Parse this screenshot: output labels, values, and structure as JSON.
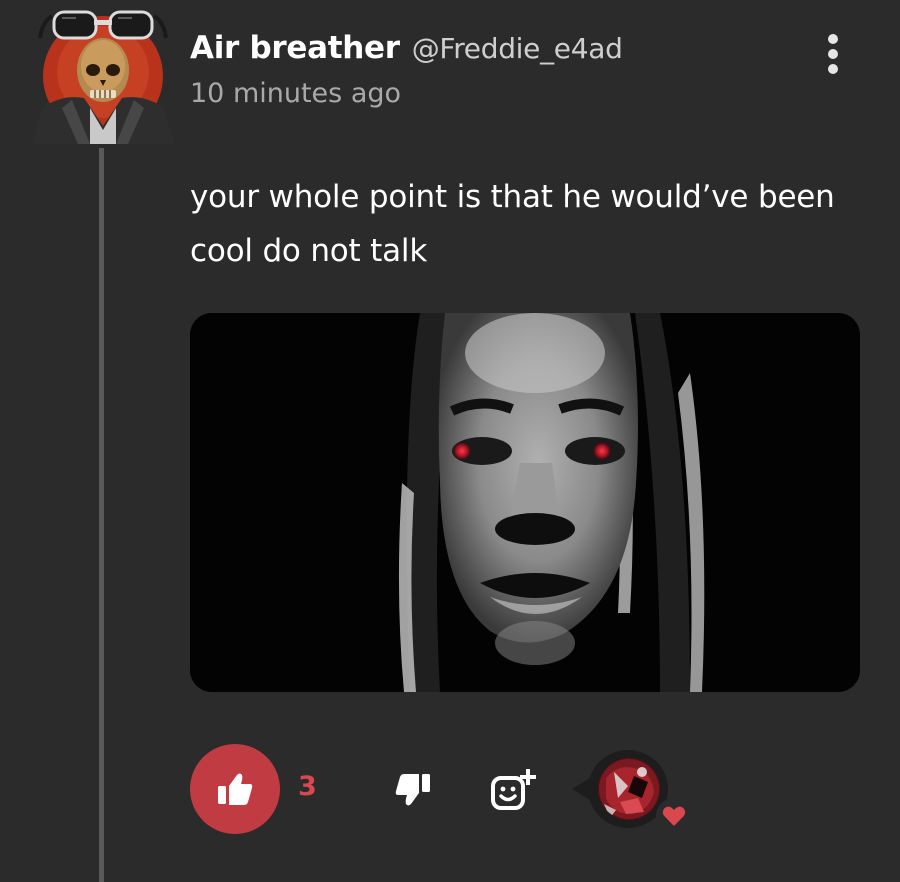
{
  "comment": {
    "author": {
      "display_name": "Air breather",
      "handle": "@Freddie_e4ad",
      "avatar_icon": "skull-with-sunglasses-avatar"
    },
    "timestamp": "10 minutes ago",
    "text": "your whole point is that he would’ve been cool do not talk",
    "media": {
      "type": "image",
      "icon": "monochrome-face-photo-red-eyes"
    },
    "actions": {
      "like_icon": "thumbs-up-icon",
      "like_count": "3",
      "dislike_icon": "thumbs-down-icon",
      "react_icon": "add-reaction-icon",
      "reactor_icon": "reactor-avatar",
      "reaction_icon": "heart-icon"
    },
    "menu_icon": "more-vertical-icon"
  },
  "colors": {
    "background": "#2b2b2b",
    "accent": "#c03c42",
    "like_count": "#d9484e",
    "thread_line": "#595959",
    "secondary_text": "#a9a9a9"
  }
}
